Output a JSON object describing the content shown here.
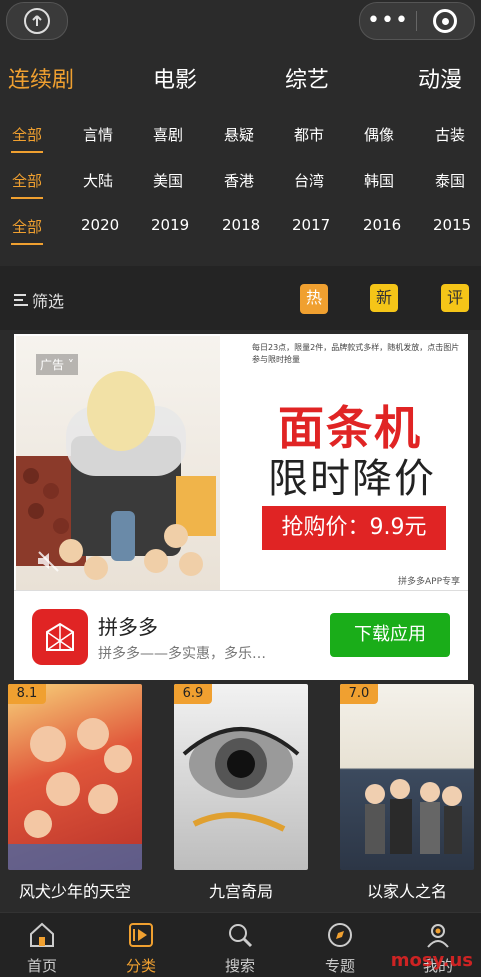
{
  "topbar": {
    "share_icon": "share-up-arrow-icon",
    "capsule_more": "•••",
    "capsule_close_icon": "target-icon"
  },
  "category_tabs": [
    {
      "label": "连续剧",
      "active": true
    },
    {
      "label": "电影",
      "active": false
    },
    {
      "label": "综艺",
      "active": false
    },
    {
      "label": "动漫",
      "active": false
    }
  ],
  "filters": {
    "genre": [
      "全部",
      "言情",
      "喜剧",
      "悬疑",
      "都市",
      "偶像",
      "古装"
    ],
    "region": [
      "全部",
      "大陆",
      "美国",
      "香港",
      "台湾",
      "韩国",
      "泰国"
    ],
    "year": [
      "全部",
      "2020",
      "2019",
      "2018",
      "2017",
      "2016",
      "2015"
    ]
  },
  "sort": {
    "filter_label": "筛选",
    "hot": "热",
    "new": "新",
    "rated": "评"
  },
  "ad": {
    "label": "广告",
    "topline": "每日23点，限量2件，品牌款式多样，随机发放，点击图片参与限时抢量",
    "title": "面条机",
    "subtitle": "限时降价",
    "price": "抢购价：9.9元",
    "footer": "拼多多APP专享",
    "app_name": "拼多多",
    "app_desc": "拼多多——多实惠，多乐…",
    "download": "下载应用",
    "colors": {
      "accent": "#e02424",
      "download": "#1aad19"
    }
  },
  "cards": [
    {
      "title": "风犬少年的天空",
      "rating": "8.1"
    },
    {
      "title": "九宫奇局",
      "rating": "6.9"
    },
    {
      "title": "以家人之名",
      "rating": "7.0"
    }
  ],
  "tabbar": [
    {
      "label": "首页",
      "icon": "home-icon",
      "active": false
    },
    {
      "label": "分类",
      "icon": "play-list-icon",
      "active": true
    },
    {
      "label": "搜索",
      "icon": "search-icon",
      "active": false
    },
    {
      "label": "专题",
      "icon": "compass-icon",
      "active": false
    },
    {
      "label": "我的",
      "icon": "user-icon",
      "active": false
    }
  ],
  "watermark": "mosy.us",
  "colors": {
    "accent": "#f0a030",
    "background": "#2b2b2b"
  }
}
